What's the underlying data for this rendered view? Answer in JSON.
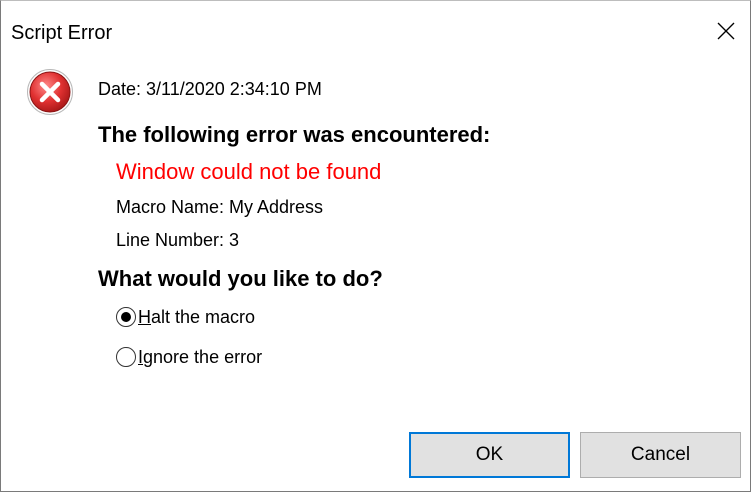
{
  "window": {
    "title": "Script Error",
    "close_icon": "close-icon"
  },
  "icon": {
    "name": "error-icon",
    "color": "#d9262a"
  },
  "body": {
    "date_text": "Date: 3/11/2020 2:34:10 PM",
    "heading_error": "The following error was encountered:",
    "error_message": "Window could not be found",
    "error_color": "#ff0000",
    "macro_name": "Macro Name: My Address",
    "line_number": "Line Number: 3",
    "heading_action": "What would you like to do?"
  },
  "options": [
    {
      "access_key": "H",
      "label_rest": "alt the macro",
      "selected": true
    },
    {
      "access_key": "I",
      "label_rest": "gnore the error",
      "selected": false
    }
  ],
  "buttons": {
    "ok_label": "OK",
    "cancel_label": "Cancel",
    "focus_color": "#0078d7"
  }
}
